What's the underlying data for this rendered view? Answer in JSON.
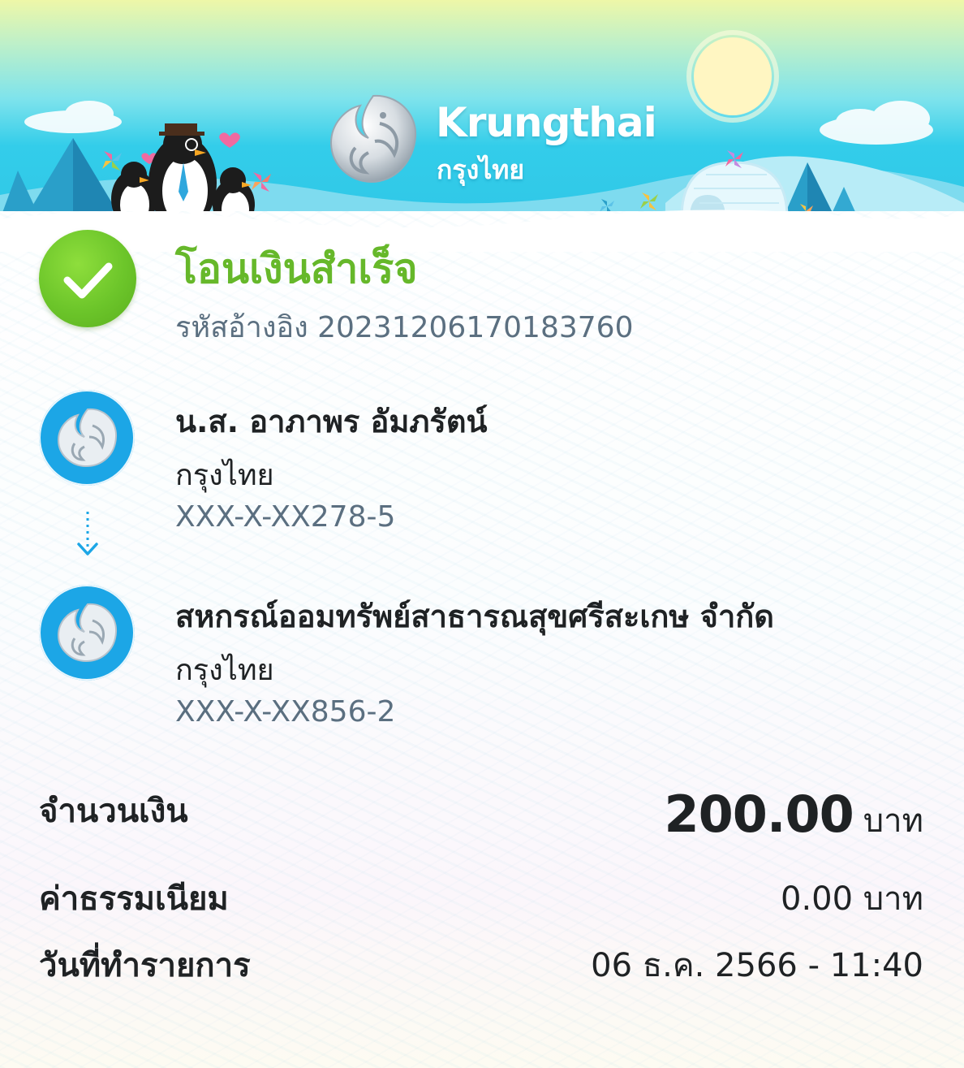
{
  "header": {
    "brand_en": "Krungthai",
    "brand_th": "กรุงไทย",
    "logo_icon": "krungthai-phoenix-logo"
  },
  "status": {
    "title": "โอนเงินสำเร็จ",
    "reference": "รหัสอ้างอิง 2023120617018376​0",
    "icon": "check-icon"
  },
  "sender": {
    "name": "น.ส. อาภาพร อัมภรัตน์",
    "bank": "กรุงไทย",
    "account": "XXX-X-XX278-5"
  },
  "receiver": {
    "name": "สหกรณ์ออมทรัพย์สาธารณสุขศรีสะเกษ จำกัด",
    "bank": "กรุงไทย",
    "account": "XXX-X-XX856-2"
  },
  "summary": {
    "amount_label": "จำนวนเงิน",
    "amount_value": "200.00",
    "amount_unit": "บาท",
    "fee_label": "ค่าธรรมเนียม",
    "fee_value": "0.00 บาท",
    "date_label": "วันที่ทำรายการ",
    "date_value": "06 ธ.ค. 2566 - 11:40"
  },
  "colors": {
    "success_green": "#66b82a",
    "bank_blue": "#1ca6e6",
    "muted_text": "#5b6f80"
  }
}
